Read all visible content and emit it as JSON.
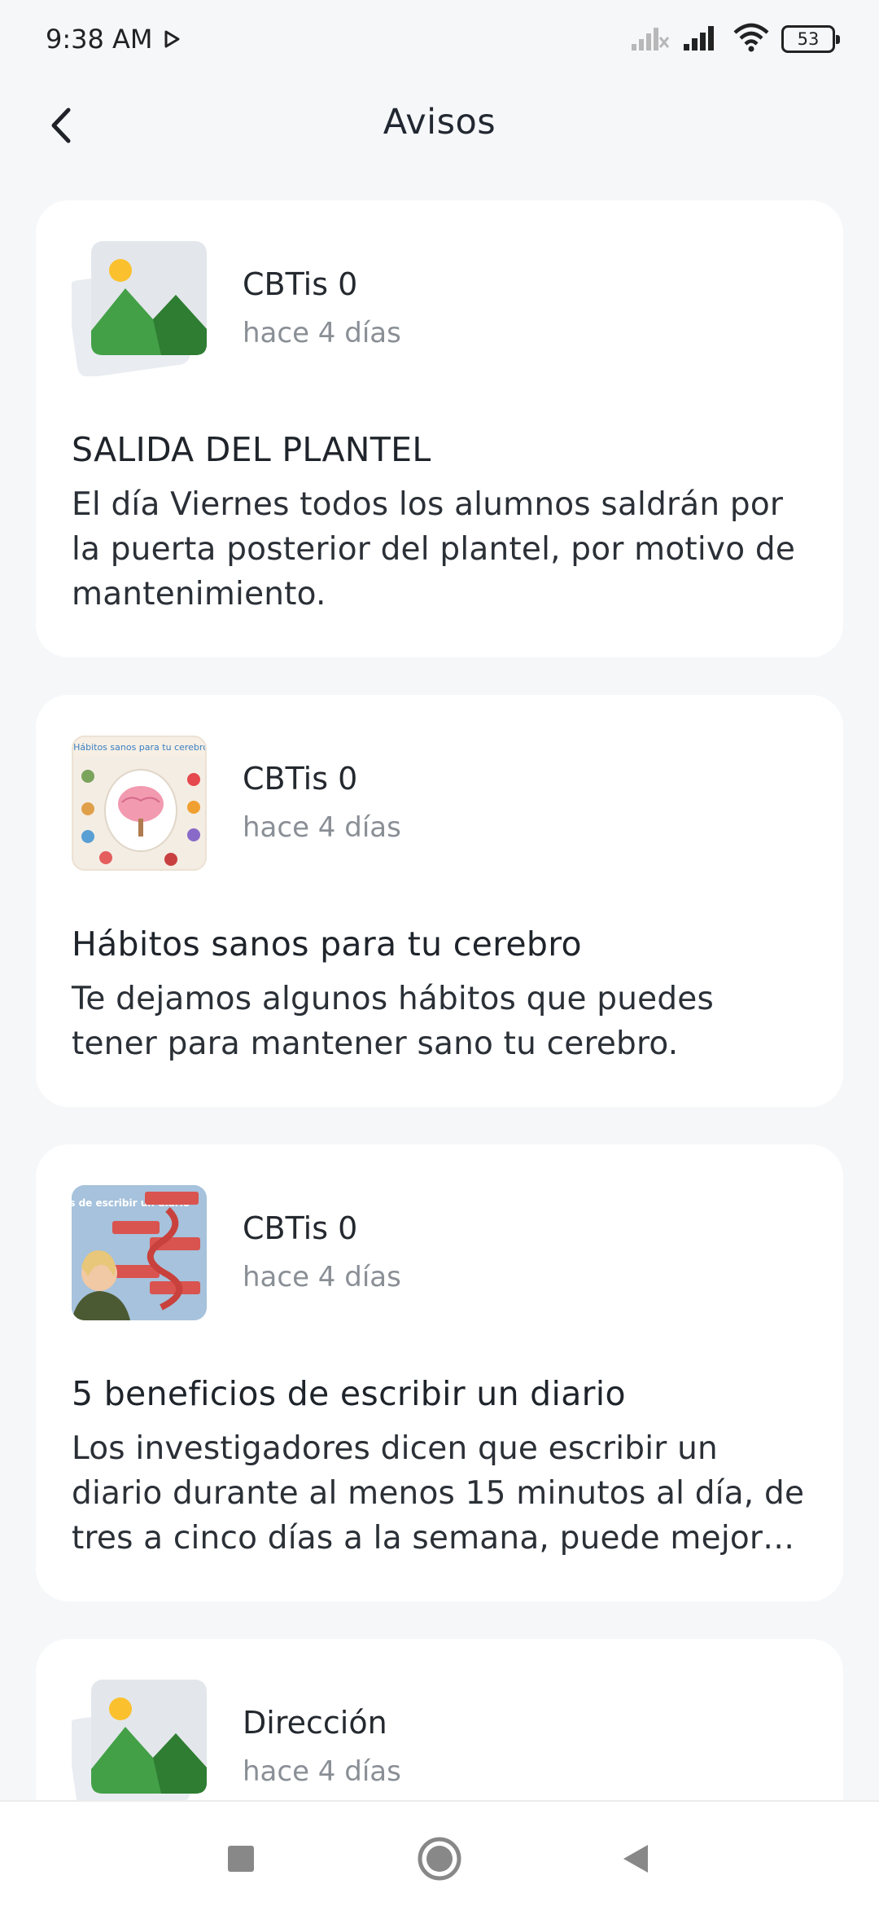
{
  "status_bar": {
    "time": "9:38 AM",
    "battery": "53"
  },
  "header": {
    "title": "Avisos",
    "back_icon": "chevron-left-icon"
  },
  "notices": [
    {
      "thumbnail": "image-placeholder-icon",
      "author": "CBTis 0",
      "time": "hace 4 días",
      "title": "SALIDA DEL PLANTEL",
      "body": "El día Viernes todos los alumnos saldrán por la puerta posterior del plantel, por motivo de mantenimiento."
    },
    {
      "thumbnail": "brain-habits-infographic",
      "thumbnail_text": "¡Hábitos sanos para tu cerebro!",
      "author": "CBTis 0",
      "time": "hace 4 días",
      "title": "Hábitos sanos para tu cerebro",
      "body": "Te dejamos algunos hábitos que puedes tener para mantener sano tu cerebro."
    },
    {
      "thumbnail": "journal-benefits-infographic",
      "thumbnail_text": "Beneficios de escribir un diario",
      "author": "CBTis 0",
      "time": "hace 4 días",
      "title": "5 beneficios de escribir un diario",
      "body": "Los investigadores dicen que escribir un diario durante al menos 15 minutos al día, de tres a cinco días a la semana, puede mejorar sig..."
    },
    {
      "thumbnail": "image-placeholder-icon",
      "author": "Dirección",
      "time": "hace 4 días",
      "title": "",
      "body": ""
    }
  ],
  "nav": {
    "recents_icon": "square-icon",
    "home_icon": "circle-icon",
    "back_icon": "triangle-back-icon"
  },
  "colors": {
    "background": "#f6f7f9",
    "card": "#ffffff",
    "placeholder_green": "#43a047",
    "placeholder_sun": "#fbc02d",
    "muted_text": "#8a8f96"
  }
}
